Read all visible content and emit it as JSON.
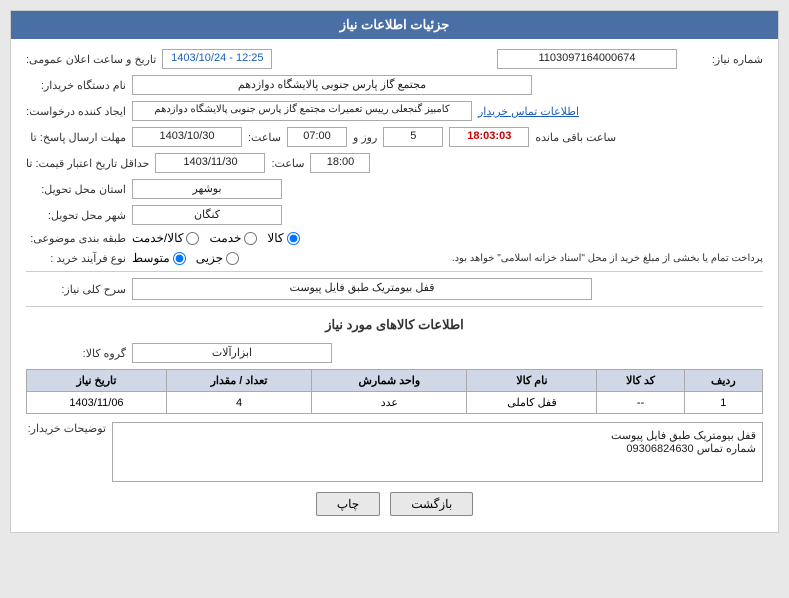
{
  "page": {
    "title": "جزئیات اطلاعات نیاز",
    "colors": {
      "header_bg": "#4a6fa5",
      "header_text": "#ffffff",
      "table_header_bg": "#d0d8e8"
    }
  },
  "form": {
    "need_number_label": "شماره نیاز:",
    "need_number_value": "1103097164000674",
    "datetime_label": "تاریخ و ساعت اعلان عمومی:",
    "datetime_value": "1403/10/24 - 12:25",
    "buyer_name_label": "نام دستگاه خریدار:",
    "buyer_name_value": "مجتمع گاز پارس جنوبی  پالایشگاه دوازدهم",
    "requester_label": "ایجاد کننده درخواست:",
    "requester_value": "کامبیز گنجعلی رییس تعمیرات مجتمع گاز پارس جنوبی  پالایشگاه دوازدهم",
    "contact_link": "اطلاعات تماس خریدار",
    "reply_deadline_label": "مهلت ارسال پاسخ: تا",
    "reply_date_value": "1403/10/30",
    "reply_time_label": "ساعت:",
    "reply_time_value": "07:00",
    "reply_day_label": "روز و",
    "reply_day_value": "5",
    "reply_remaining_label": "ساعت باقی مانده",
    "reply_remaining_value": "18:03:03",
    "price_deadline_label": "حداقل تاریخ اعتبار قیمت: تا",
    "price_date_value": "1403/11/30",
    "price_time_label": "ساعت:",
    "price_time_value": "18:00",
    "province_label": "استان محل تحویل:",
    "province_value": "بوشهر",
    "city_label": "شهر محل تحویل:",
    "city_value": "کنگان",
    "category_label": "طبقه بندی موضوعی:",
    "category_options": [
      "کالا",
      "خدمت",
      "کالا/خدمت"
    ],
    "category_selected": "کالا",
    "purchase_type_label": "نوع فرآیند خرید :",
    "purchase_options": [
      "جزیی",
      "متوسط"
    ],
    "purchase_selected": "متوسط",
    "purchase_note": "پرداخت تمام یا بخشی از مبلغ خرید از محل \"اسناد خزانه اسلامی\" خواهد بود.",
    "need_description_label": "سرح کلی نیاز:",
    "need_description_value": "قفل بیومتریک طبق فایل پیوست",
    "goods_section_title": "اطلاعات کالاهای مورد نیاز",
    "goods_group_label": "گروه کالا:",
    "goods_group_value": "ابزارآلات",
    "table": {
      "headers": [
        "ردیف",
        "کد کالا",
        "نام کالا",
        "واحد شمارش",
        "تعداد / مقدار",
        "تاریخ نیاز"
      ],
      "rows": [
        {
          "row": "1",
          "code": "--",
          "name": "قفل کاملی",
          "unit": "عدد",
          "quantity": "4",
          "date": "1403/11/06"
        }
      ]
    },
    "buyer_comments_label": "توضیحات خریدار:",
    "buyer_comments_value": "قفل بیومتریک طبق فایل پیوست\nشماره تماس 09306824630"
  },
  "buttons": {
    "print_label": "چاپ",
    "back_label": "بازگشت"
  }
}
